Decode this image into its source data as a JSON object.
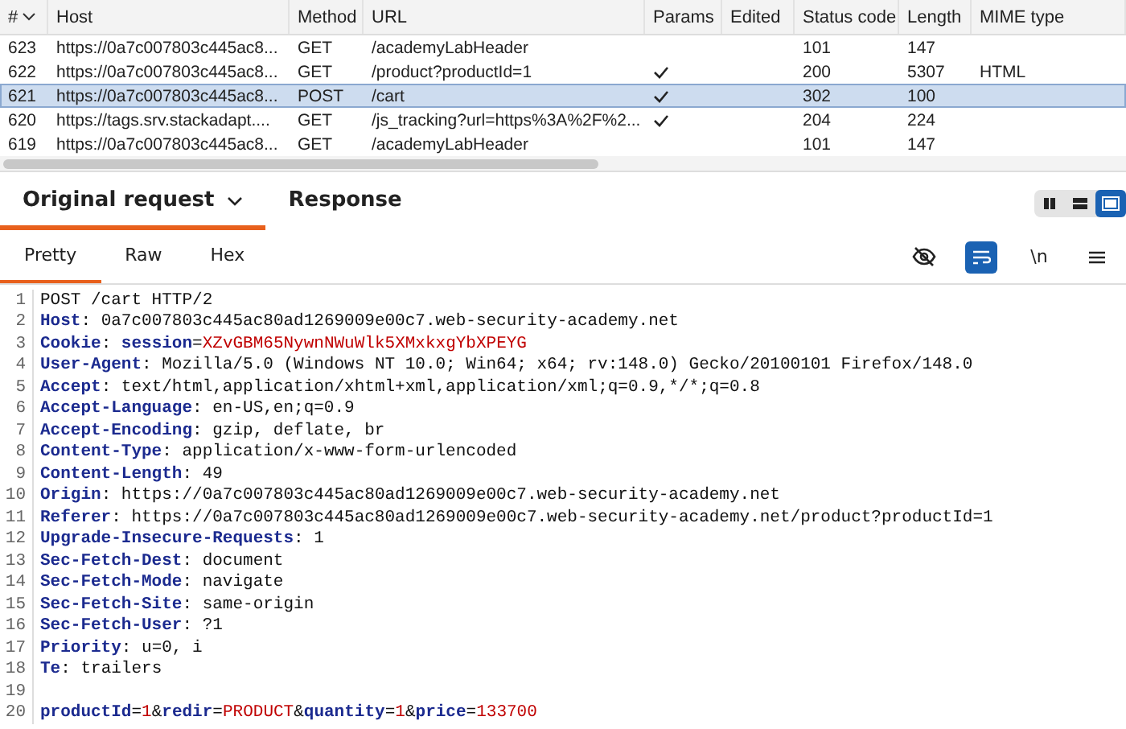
{
  "table": {
    "columns": [
      "#",
      "Host",
      "Method",
      "URL",
      "Params",
      "Edited",
      "Status code",
      "Length",
      "MIME type"
    ],
    "rows": [
      {
        "num": "623",
        "host": "https://0a7c007803c445ac8...",
        "method": "GET",
        "url": "/academyLabHeader",
        "params": false,
        "status": "101",
        "length": "147",
        "selected": false
      },
      {
        "num": "622",
        "host": "https://0a7c007803c445ac8...",
        "method": "GET",
        "url": "/product?productId=1",
        "params": true,
        "status": "200",
        "length": "5307",
        "mime": "HTML",
        "selected": false
      },
      {
        "num": "621",
        "host": "https://0a7c007803c445ac8...",
        "method": "POST",
        "url": "/cart",
        "params": true,
        "status": "302",
        "length": "100",
        "selected": true
      },
      {
        "num": "620",
        "host": "https://tags.srv.stackadapt....",
        "method": "GET",
        "url": "/js_tracking?url=https%3A%2F%2...",
        "params": true,
        "status": "204",
        "length": "224",
        "selected": false
      },
      {
        "num": "619",
        "host": "https://0a7c007803c445ac8...",
        "method": "GET",
        "url": "/academyLabHeader",
        "params": false,
        "status": "101",
        "length": "147",
        "selected": false
      }
    ]
  },
  "panel_tabs": [
    {
      "label": "Original request",
      "selected": true,
      "dropdown": true
    },
    {
      "label": "Response",
      "selected": false,
      "dropdown": false
    }
  ],
  "layout_buttons": [
    {
      "kind": "columns",
      "selected": false
    },
    {
      "kind": "rows",
      "selected": false
    },
    {
      "kind": "single",
      "selected": true
    }
  ],
  "view_tabs": [
    {
      "label": "Pretty",
      "selected": true
    },
    {
      "label": "Raw",
      "selected": false
    },
    {
      "label": "Hex",
      "selected": false
    }
  ],
  "editor_tools": [
    {
      "kind": "hide",
      "on": false
    },
    {
      "kind": "wrap",
      "on": true
    },
    {
      "kind": "newline",
      "label": "\\n",
      "on": false
    },
    {
      "kind": "menu",
      "on": false
    }
  ],
  "code_lines": [
    {
      "number": "1",
      "segments": [
        {
          "kind": "plain",
          "text": "POST /cart HTTP/2"
        }
      ]
    },
    {
      "number": "2",
      "segments": [
        {
          "kind": "key",
          "text": "Host"
        },
        {
          "kind": "plain",
          "text": ": 0a7c007803c445ac80ad1269009e00c7.web-security-academy.net"
        }
      ]
    },
    {
      "number": "3",
      "segments": [
        {
          "kind": "key",
          "text": "Cookie"
        },
        {
          "kind": "plain",
          "text": ": "
        },
        {
          "kind": "param",
          "text": "session"
        },
        {
          "kind": "plain",
          "text": "="
        },
        {
          "kind": "value",
          "text": "XZvGBM65NywnNWuWlk5XMxkxgYbXPEYG"
        }
      ]
    },
    {
      "number": "4",
      "segments": [
        {
          "kind": "key",
          "text": "User-Agent"
        },
        {
          "kind": "plain",
          "text": ": Mozilla/5.0 (Windows NT 10.0; Win64; x64; rv:148.0) Gecko/20100101 Firefox/148.0"
        }
      ]
    },
    {
      "number": "5",
      "segments": [
        {
          "kind": "key",
          "text": "Accept"
        },
        {
          "kind": "plain",
          "text": ": text/html,application/xhtml+xml,application/xml;q=0.9,*/*;q=0.8"
        }
      ]
    },
    {
      "number": "6",
      "segments": [
        {
          "kind": "key",
          "text": "Accept-Language"
        },
        {
          "kind": "plain",
          "text": ": en-US,en;q=0.9"
        }
      ]
    },
    {
      "number": "7",
      "segments": [
        {
          "kind": "key",
          "text": "Accept-Encoding"
        },
        {
          "kind": "plain",
          "text": ": gzip, deflate, br"
        }
      ]
    },
    {
      "number": "8",
      "segments": [
        {
          "kind": "key",
          "text": "Content-Type"
        },
        {
          "kind": "plain",
          "text": ": application/x-www-form-urlencoded"
        }
      ]
    },
    {
      "number": "9",
      "segments": [
        {
          "kind": "key",
          "text": "Content-Length"
        },
        {
          "kind": "plain",
          "text": ": 49"
        }
      ]
    },
    {
      "number": "10",
      "segments": [
        {
          "kind": "key",
          "text": "Origin"
        },
        {
          "kind": "plain",
          "text": ": https://0a7c007803c445ac80ad1269009e00c7.web-security-academy.net"
        }
      ]
    },
    {
      "number": "11",
      "segments": [
        {
          "kind": "key",
          "text": "Referer"
        },
        {
          "kind": "plain",
          "text": ": https://0a7c007803c445ac80ad1269009e00c7.web-security-academy.net/product?productId=1"
        }
      ]
    },
    {
      "number": "12",
      "segments": [
        {
          "kind": "key",
          "text": "Upgrade-Insecure-Requests"
        },
        {
          "kind": "plain",
          "text": ": 1"
        }
      ]
    },
    {
      "number": "13",
      "segments": [
        {
          "kind": "key",
          "text": "Sec-Fetch-Dest"
        },
        {
          "kind": "plain",
          "text": ": document"
        }
      ]
    },
    {
      "number": "14",
      "segments": [
        {
          "kind": "key",
          "text": "Sec-Fetch-Mode"
        },
        {
          "kind": "plain",
          "text": ": navigate"
        }
      ]
    },
    {
      "number": "15",
      "segments": [
        {
          "kind": "key",
          "text": "Sec-Fetch-Site"
        },
        {
          "kind": "plain",
          "text": ": same-origin"
        }
      ]
    },
    {
      "number": "16",
      "segments": [
        {
          "kind": "key",
          "text": "Sec-Fetch-User"
        },
        {
          "kind": "plain",
          "text": ": ?1"
        }
      ]
    },
    {
      "number": "17",
      "segments": [
        {
          "kind": "key",
          "text": "Priority"
        },
        {
          "kind": "plain",
          "text": ": u=0, i"
        }
      ]
    },
    {
      "number": "18",
      "segments": [
        {
          "kind": "key",
          "text": "Te"
        },
        {
          "kind": "plain",
          "text": ": trailers"
        }
      ]
    },
    {
      "number": "19"
    },
    {
      "number": "20",
      "segments": [
        {
          "kind": "param",
          "text": "productId"
        },
        {
          "kind": "plain",
          "text": "="
        },
        {
          "kind": "value",
          "text": "1"
        },
        {
          "kind": "plain",
          "text": "&"
        },
        {
          "kind": "param",
          "text": "redir"
        },
        {
          "kind": "plain",
          "text": "="
        },
        {
          "kind": "value",
          "text": "PRODUCT"
        },
        {
          "kind": "plain",
          "text": "&"
        },
        {
          "kind": "param",
          "text": "quantity"
        },
        {
          "kind": "plain",
          "text": "="
        },
        {
          "kind": "value",
          "text": "1"
        },
        {
          "kind": "plain",
          "text": "&"
        },
        {
          "kind": "param",
          "text": "price"
        },
        {
          "kind": "plain",
          "text": "="
        },
        {
          "kind": "value",
          "text": "133700"
        }
      ]
    }
  ]
}
